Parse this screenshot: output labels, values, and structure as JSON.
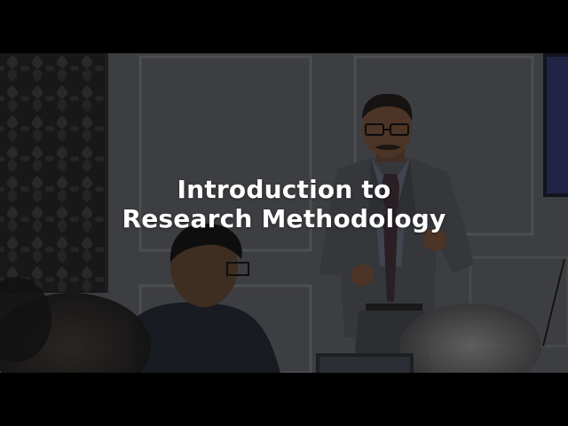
{
  "video": {
    "title_line_1": "Introduction to",
    "title_line_2": "Research Methodology"
  },
  "colors": {
    "letterbox": "#000000",
    "title_text": "#ffffff",
    "wall": "#55575a",
    "curtain": "#2a2a2b",
    "suit": "#4a4d52",
    "tie": "#3a2c33"
  }
}
